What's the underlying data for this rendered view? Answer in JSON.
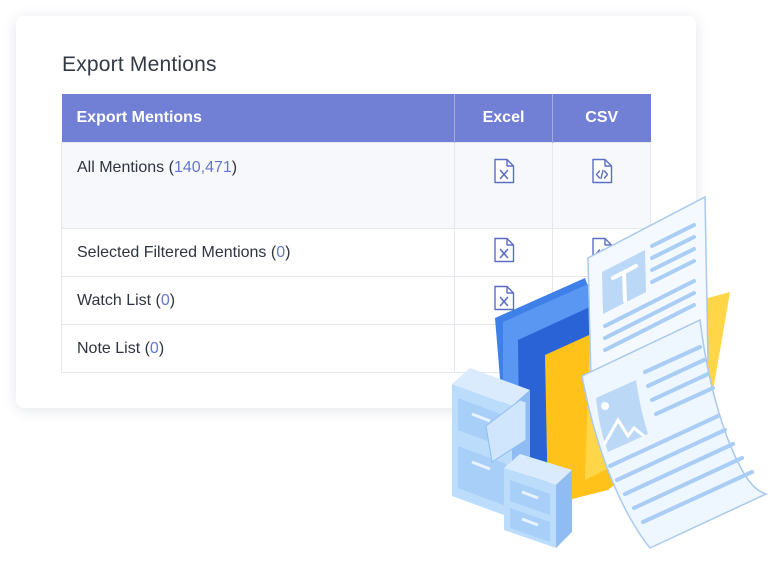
{
  "panel": {
    "title": "Export Mentions"
  },
  "table": {
    "headers": {
      "name": "Export Mentions",
      "excel": "Excel",
      "csv": "CSV"
    },
    "rows": [
      {
        "label": "All Mentions",
        "count": "140,471",
        "excel": true,
        "csv": true
      },
      {
        "label": "Selected Filtered Mentions",
        "count": "0",
        "excel": true,
        "csv": true
      },
      {
        "label": "Watch List",
        "count": "0",
        "excel": true,
        "csv": false
      },
      {
        "label": "Note List",
        "count": "0",
        "excel": false,
        "csv": false
      }
    ],
    "paren_open": "(",
    "paren_close": ")"
  },
  "icons": {
    "excel": "excel-file-icon",
    "csv": "csv-file-icon",
    "illustration": "file-cabinet-documents-illustration"
  },
  "colors": {
    "header_bg": "#717fd5",
    "count_text": "#6476cf",
    "icon_stroke": "#5a6fc4"
  }
}
